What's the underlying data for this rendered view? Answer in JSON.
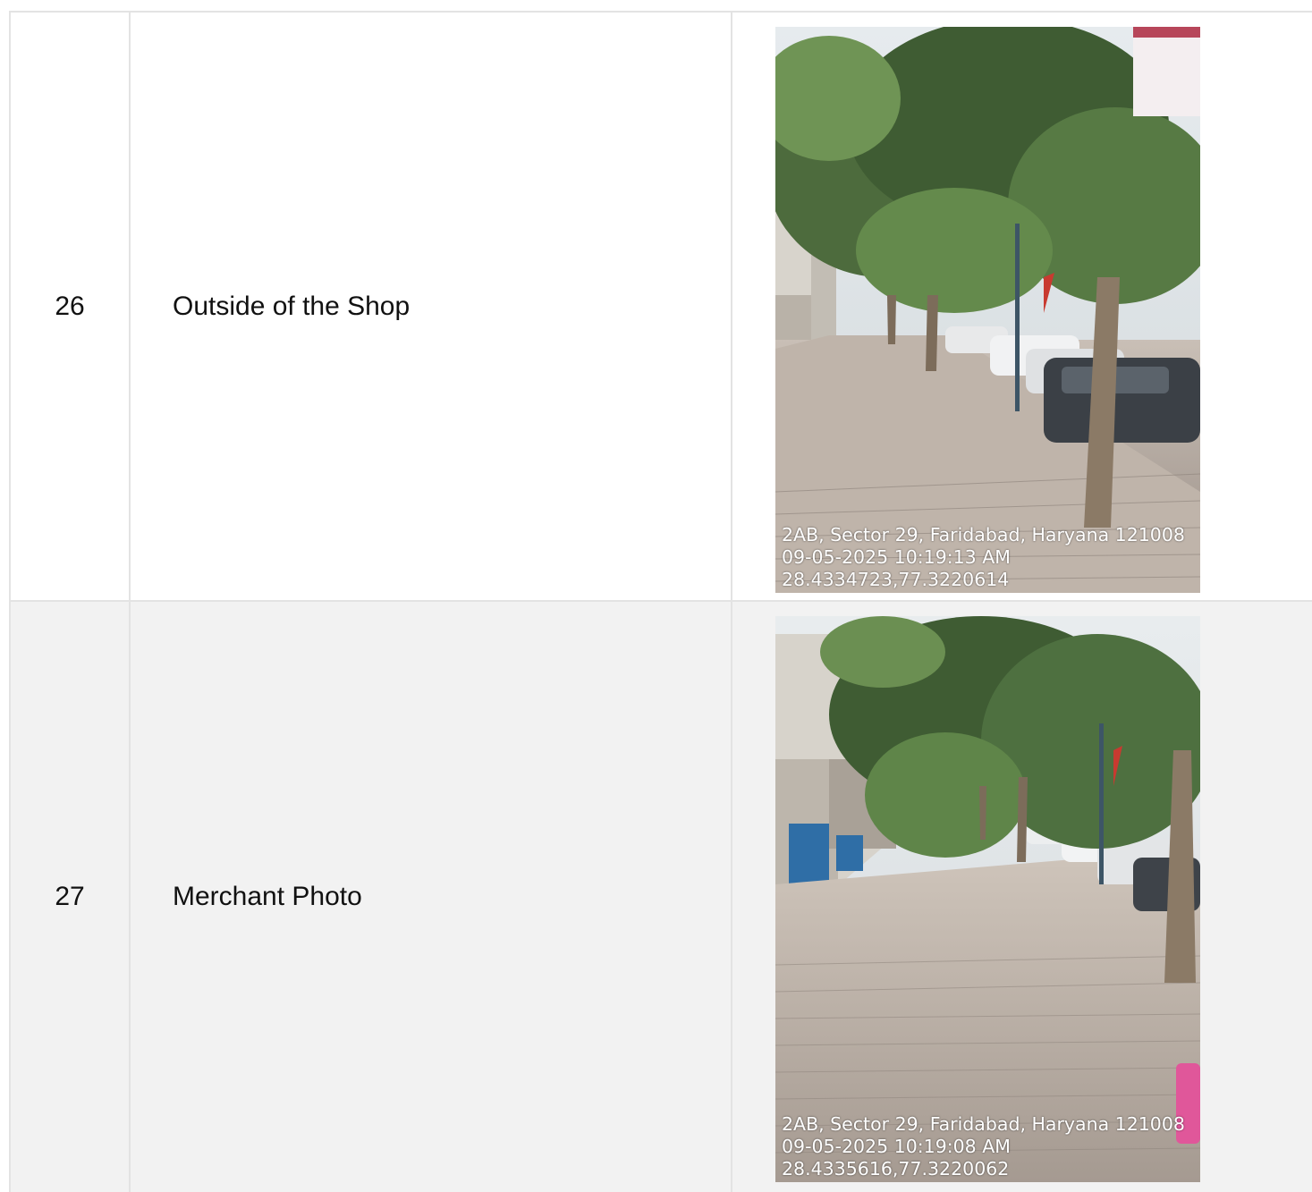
{
  "rows": [
    {
      "index": "26",
      "label": "Outside of the Shop",
      "photo": {
        "address": "2AB, Sector 29, Faridabad, Haryana 121008",
        "datetime": "09-05-2025 10:19:13 AM",
        "coords": "28.4334723,77.3220614"
      }
    },
    {
      "index": "27",
      "label": "Merchant Photo",
      "photo": {
        "address": "2AB, Sector 29, Faridabad, Haryana 121008",
        "datetime": "09-05-2025 10:19:08 AM",
        "coords": "28.4335616,77.3220062"
      }
    }
  ],
  "colors": {
    "border": "#e3e3e3",
    "alt_row": "#f2f2f2",
    "stamp_text": "#ffffff"
  }
}
